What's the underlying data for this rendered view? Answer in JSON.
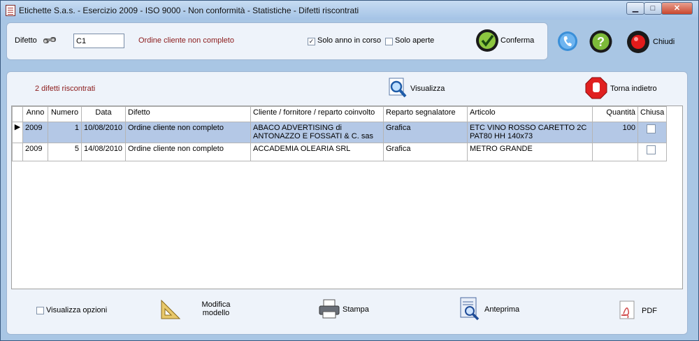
{
  "window": {
    "title": "Etichette S.a.s. - Esercizio 2009 - ISO 9000 - Non conformità - Statistiche - Difetti riscontrati",
    "min": "▁",
    "max": "□",
    "close": "✕"
  },
  "filters": {
    "difetto_label": "Difetto",
    "difetto_value": "C1",
    "difetto_description": "Ordine cliente non completo",
    "solo_anno_label": "Solo anno in corso",
    "solo_anno_checked": true,
    "solo_aperte_label": "Solo aperte",
    "solo_aperte_checked": false,
    "conferma_label": "Conferma"
  },
  "toolbar": {
    "chiudi_label": "Chiudi"
  },
  "results": {
    "count_text": "2 difetti riscontrati",
    "visualizza_label": "Visualizza",
    "torna_label": "Torna indietro"
  },
  "table": {
    "columns": [
      "Anno",
      "Numero",
      "Data",
      "Difetto",
      "Cliente / fornitore / reparto coinvolto",
      "Reparto segnalatore",
      "Articolo",
      "Quantità",
      "Chiusa"
    ],
    "rows": [
      {
        "anno": "2009",
        "numero": "1",
        "data": "10/08/2010",
        "difetto": "Ordine cliente non completo",
        "cliente": "ABACO ADVERTISING di ANTONAZZO E FOSSATI & C. sas",
        "reparto": "Grafica",
        "articolo": "ETC VINO ROSSO CARETTO 2C PAT80 HH 140x73",
        "quantita": "100",
        "chiusa": false
      },
      {
        "anno": "2009",
        "numero": "5",
        "data": "14/08/2010",
        "difetto": "Ordine cliente non completo",
        "cliente": "ACCADEMIA OLEARIA SRL",
        "reparto": "Grafica",
        "articolo": "METRO GRANDE",
        "quantita": "",
        "chiusa": false
      }
    ]
  },
  "footer": {
    "visualizza_opzioni_label": "Visualizza opzioni",
    "modifica_modello_label": "Modifica modello",
    "stampa_label": "Stampa",
    "anteprima_label": "Anteprima",
    "pdf_label": "PDF"
  }
}
